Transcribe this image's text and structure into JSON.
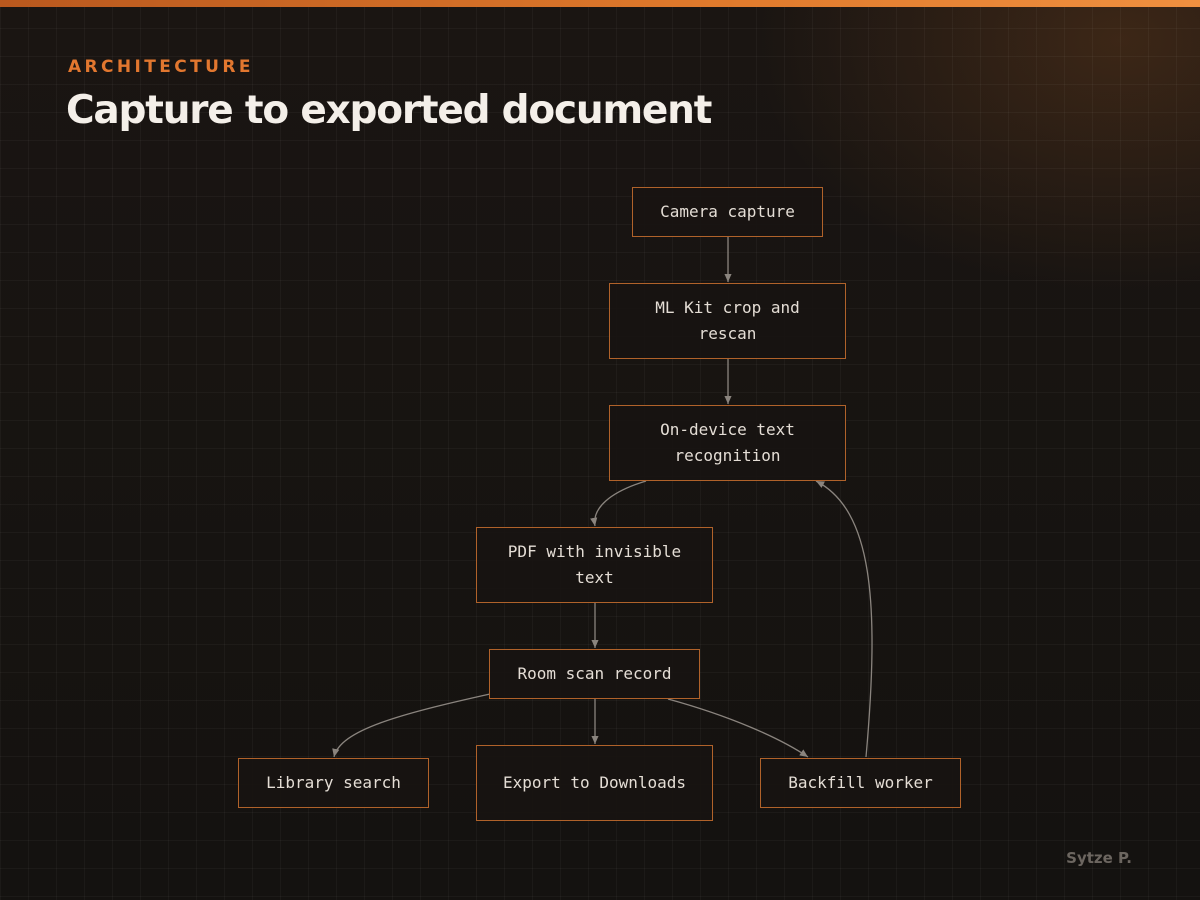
{
  "header": {
    "eyebrow": "ARCHITECTURE",
    "title": "Capture to exported document"
  },
  "diagram": {
    "nodes": {
      "camera_capture": "Camera capture",
      "ml_kit_crop": "ML Kit crop and rescan",
      "text_recognition": "On-device text recognition",
      "pdf_invisible_text": "PDF with invisible text",
      "room_scan_record": "Room scan record",
      "library_search": "Library search",
      "export_downloads": "Export to Downloads",
      "backfill_worker": "Backfill worker"
    },
    "edges": [
      {
        "from": "camera_capture",
        "to": "ml_kit_crop"
      },
      {
        "from": "ml_kit_crop",
        "to": "text_recognition"
      },
      {
        "from": "text_recognition",
        "to": "pdf_invisible_text"
      },
      {
        "from": "pdf_invisible_text",
        "to": "room_scan_record"
      },
      {
        "from": "room_scan_record",
        "to": "library_search"
      },
      {
        "from": "room_scan_record",
        "to": "export_downloads"
      },
      {
        "from": "room_scan_record",
        "to": "backfill_worker"
      },
      {
        "from": "backfill_worker",
        "to": "text_recognition"
      }
    ]
  },
  "footer": {
    "credit": "Sytze P."
  },
  "colors": {
    "accent": "#e2772f",
    "node_border": "#b0622a",
    "edge": "#8a847e",
    "text": "#e4ddd5"
  }
}
